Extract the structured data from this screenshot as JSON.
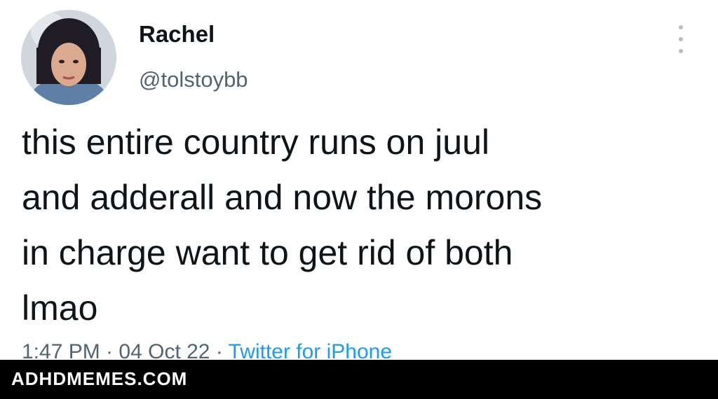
{
  "tweet": {
    "display_name": "Rachel",
    "handle": "@tolstoybb",
    "text": "this entire country runs on juul\nand adderall and now the morons\nin charge want to get rid of both\nlmao",
    "time": "1:47 PM",
    "separator": " · ",
    "date": "04 Oct 22",
    "source": "Twitter for iPhone"
  },
  "icons": {
    "more": "more-vertical-icon"
  },
  "watermark": {
    "text": "ADHDMEMES.COM"
  },
  "colors": {
    "text": "#0f1419",
    "secondary": "#536471",
    "link": "#1d9bf0",
    "watermark_bar": "#000000"
  }
}
